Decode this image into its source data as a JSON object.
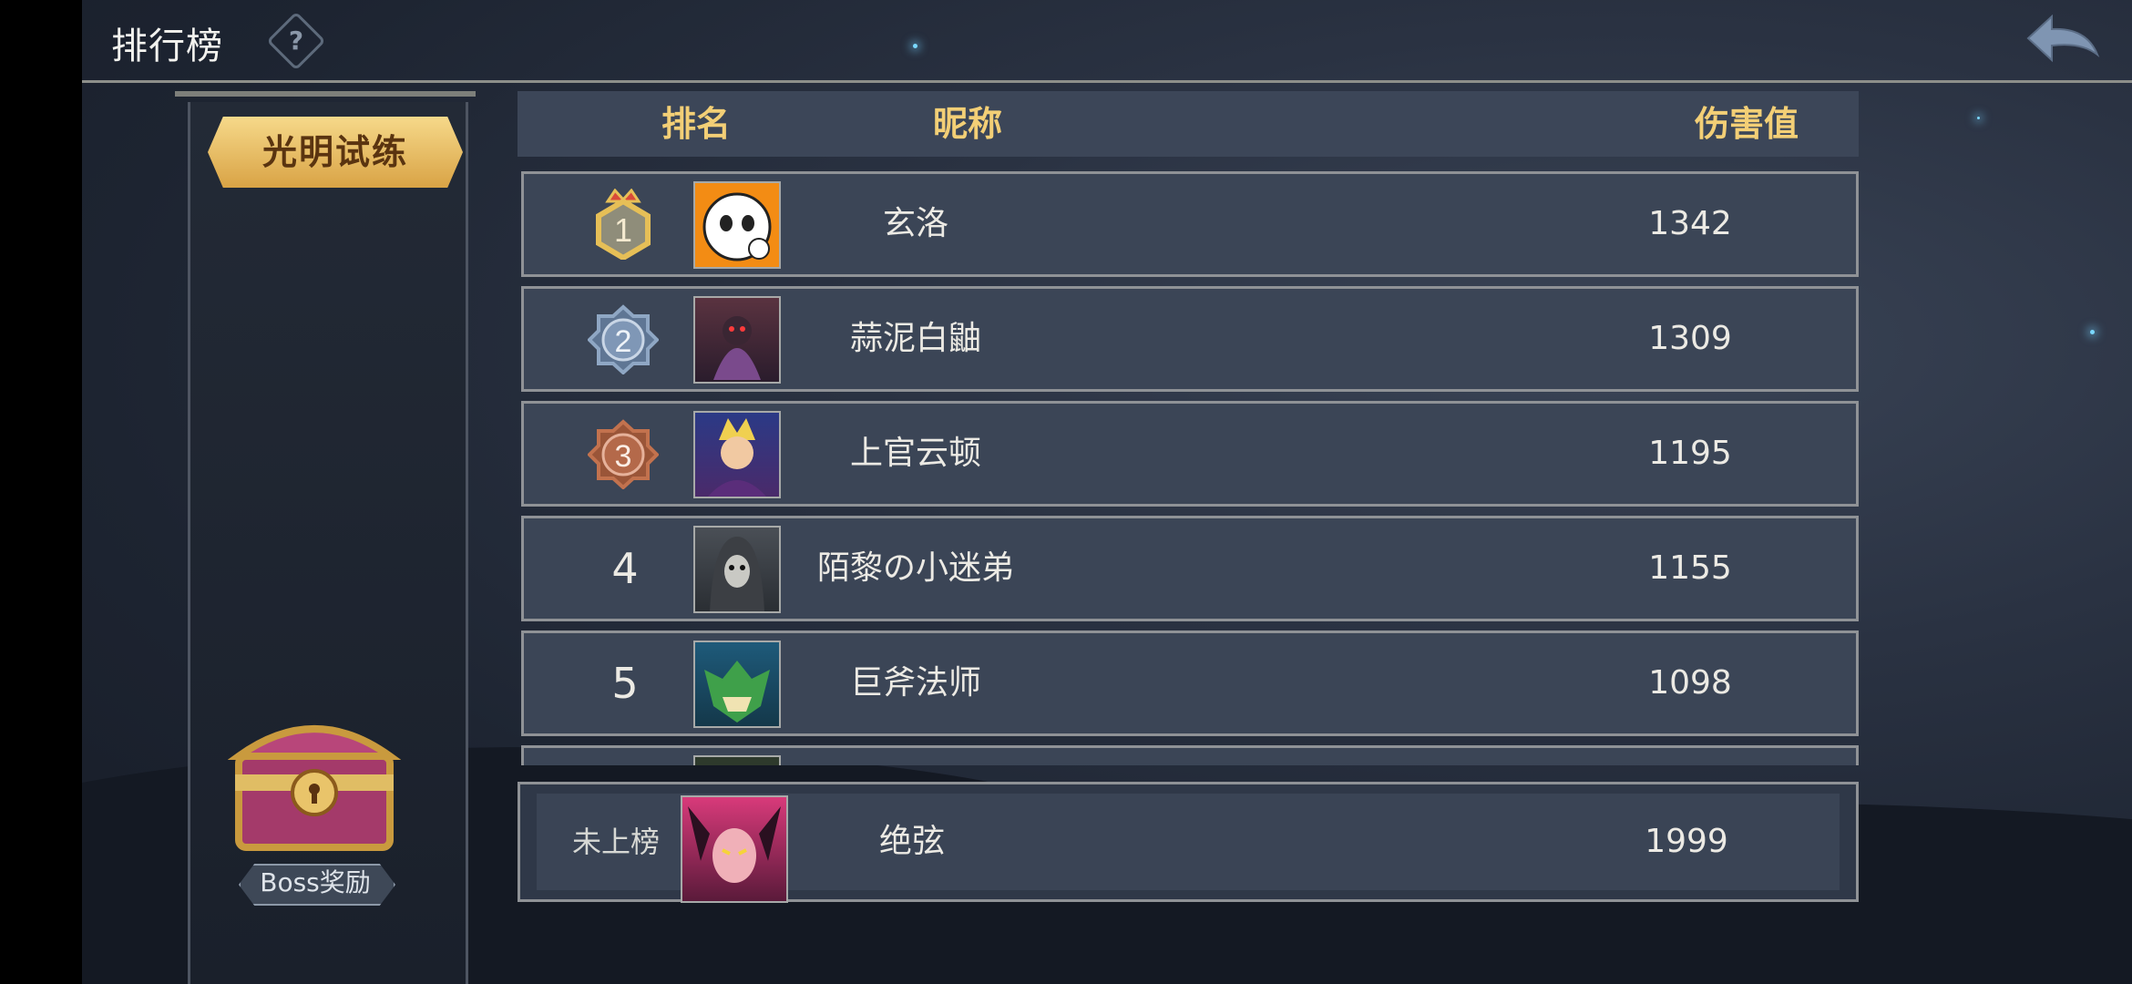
{
  "header": {
    "title": "排行榜",
    "help_icon": "help-icon",
    "back_icon": "back-arrow-icon"
  },
  "mode": {
    "label": "光明试练"
  },
  "reward": {
    "label": "Boss奖励",
    "icon": "treasure-chest-icon"
  },
  "table": {
    "columns": {
      "rank": "排名",
      "nickname": "昵称",
      "damage": "伤害值"
    },
    "rows": [
      {
        "rank": "1",
        "name": "玄洛",
        "score": "1342",
        "medal": "gold"
      },
      {
        "rank": "2",
        "name": "蒜泥白鼬",
        "score": "1309",
        "medal": "silver"
      },
      {
        "rank": "3",
        "name": "上官云顿",
        "score": "1195",
        "medal": "bronze"
      },
      {
        "rank": "4",
        "name": "陌黎の小迷弟",
        "score": "1155"
      },
      {
        "rank": "5",
        "name": "巨斧法师",
        "score": "1098"
      }
    ]
  },
  "me": {
    "rank": "未上榜",
    "name": "绝弦",
    "score": "1999"
  },
  "colors": {
    "accent_gold": "#f3cf76",
    "panel": "#3b4556",
    "medal_gold": "#e6bf57",
    "medal_silver": "#8fa7c4",
    "medal_bronze": "#c2724e"
  }
}
